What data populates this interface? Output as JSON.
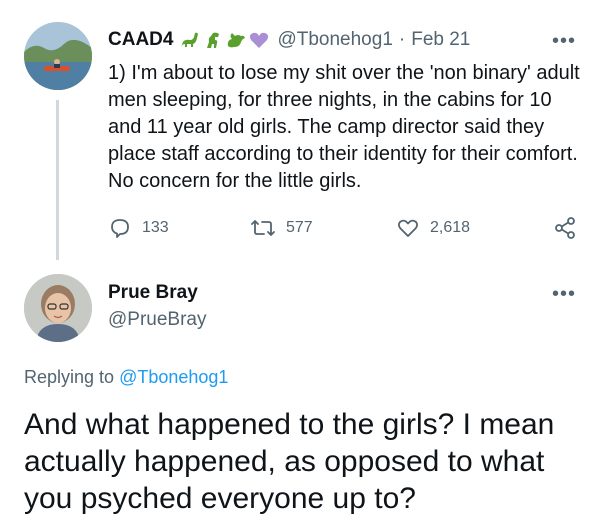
{
  "tweet": {
    "name": "CAAD4",
    "handle": "@Tbonehog1",
    "separator": "·",
    "date": "Feb 21",
    "text": "1) I'm about to lose my shit over the 'non binary' adult men sleeping, for three nights, in the cabins for 10 and 11 year old girls. The camp director said they place staff according to their identity for their comfort. No concern for the little girls.",
    "more": "•••",
    "replies": "133",
    "retweets": "577",
    "likes": "2,618",
    "icons": [
      "sauropod-emoji",
      "t-rex-emoji",
      "dragon-emoji",
      "purple-heart-emoji",
      "reply-icon",
      "retweet-icon",
      "like-icon",
      "share-icon"
    ]
  },
  "reply": {
    "name": "Prue Bray",
    "handle": "@PrueBray",
    "more": "•••",
    "replying_prefix": "Replying to",
    "replying_handle": "@Tbonehog1",
    "text": "And what happened to the girls? I mean actually happened, as opposed to what you psyched everyone up to?"
  },
  "colors": {
    "link": "#1d9bf0",
    "secondary": "#536471",
    "thread_line": "#cfd9de",
    "emoji_green": "#5aa02c",
    "emoji_purple": "#aa8ed6"
  }
}
